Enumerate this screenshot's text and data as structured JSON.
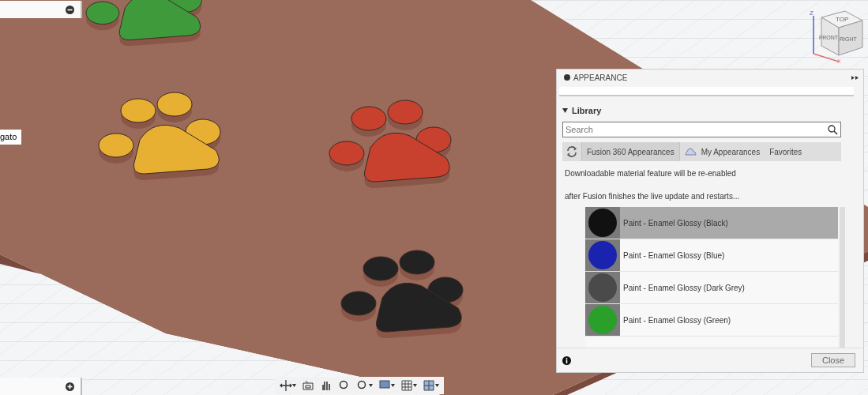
{
  "left_label": {
    "text": "gato"
  },
  "viewcube": {
    "top": "TOP",
    "front": "FRONT",
    "right": "RIGHT",
    "z_axis": "Z",
    "x_axis": "X"
  },
  "paws": [
    {
      "color": "#3f9a3c"
    },
    {
      "color": "#e8b032"
    },
    {
      "color": "#c8402e"
    },
    {
      "color": "#222222"
    }
  ],
  "panel": {
    "title": "APPEARANCE",
    "section": "Library",
    "search": {
      "placeholder": "Search"
    },
    "tabs": [
      {
        "label": "Fusion 360 Appearances",
        "selected": true
      },
      {
        "label": "My Appearances",
        "selected": false
      },
      {
        "label": "Favorites",
        "selected": false
      }
    ],
    "notice": [
      "Downloadable material feature will be re-enabled",
      "after Fusion finishes the live update and restarts..."
    ],
    "materials": [
      {
        "name": "Paint - Enamel Glossy (Black)",
        "color": "#111111",
        "selected": true
      },
      {
        "name": "Paint - Enamel Glossy (Blue)",
        "color": "#1a22b0",
        "selected": false
      },
      {
        "name": "Paint - Enamel Glossy (Dark Grey)",
        "color": "#4a4a4a",
        "selected": false
      },
      {
        "name": "Paint - Enamel Glossy (Green)",
        "color": "#2aa02a",
        "selected": false
      }
    ],
    "close": "Close"
  }
}
